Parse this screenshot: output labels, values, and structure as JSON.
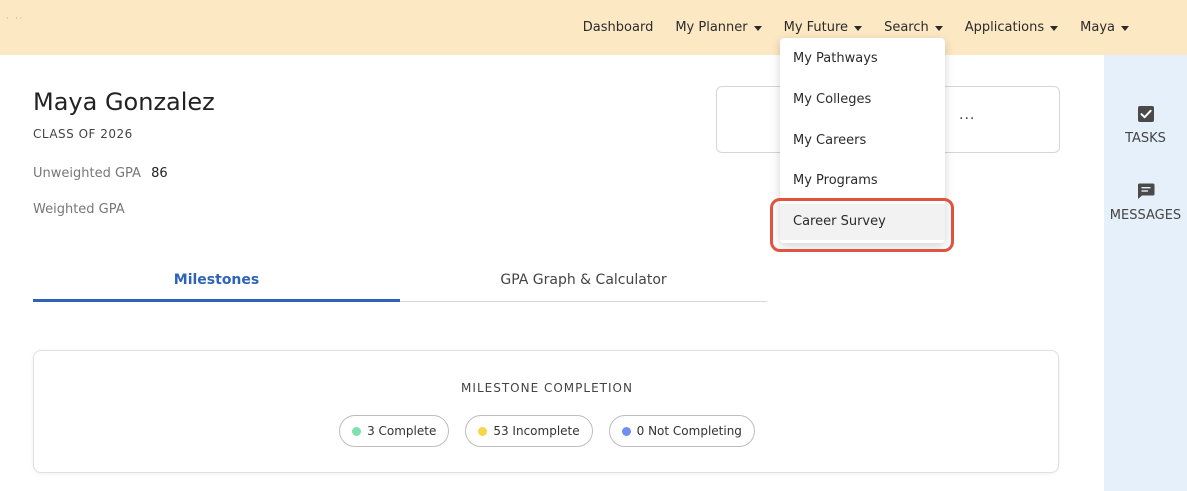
{
  "nav": {
    "items": [
      {
        "label": "Dashboard",
        "caret": false
      },
      {
        "label": "My Planner",
        "caret": true
      },
      {
        "label": "My Future",
        "caret": true
      },
      {
        "label": "Search",
        "caret": true
      },
      {
        "label": "Applications",
        "caret": true
      },
      {
        "label": "Maya",
        "caret": true
      }
    ]
  },
  "dropdown": {
    "items": [
      {
        "label": "My Pathways"
      },
      {
        "label": "My Colleges"
      },
      {
        "label": "My Careers"
      },
      {
        "label": "My Programs"
      },
      {
        "label": "Career Survey"
      }
    ],
    "highlighted": "Career Survey"
  },
  "profile": {
    "name": "Maya Gonzalez",
    "class_of": "CLASS OF 2026",
    "unweighted_label": "Unweighted GPA",
    "unweighted_value": "86",
    "weighted_label": "Weighted GPA",
    "weighted_value": ""
  },
  "card": {
    "more": "..."
  },
  "tabs": [
    {
      "label": "Milestones",
      "active": true
    },
    {
      "label": "GPA Graph & Calculator",
      "active": false
    }
  ],
  "milestones": {
    "title": "MILESTONE COMPLETION",
    "pills": [
      {
        "label": "3 Complete",
        "color": "#7fe0b0"
      },
      {
        "label": "53 Incomplete",
        "color": "#f7d54a"
      },
      {
        "label": "0 Not Completing",
        "color": "#6f8ef0"
      }
    ]
  },
  "sidebar": {
    "tasks_label": "TASKS",
    "messages_label": "MESSAGES"
  },
  "colors": {
    "topbar": "#fde8c4",
    "accent": "#2e63b8",
    "highlight": "#e0533f",
    "sidebar": "#e6f0fb"
  }
}
